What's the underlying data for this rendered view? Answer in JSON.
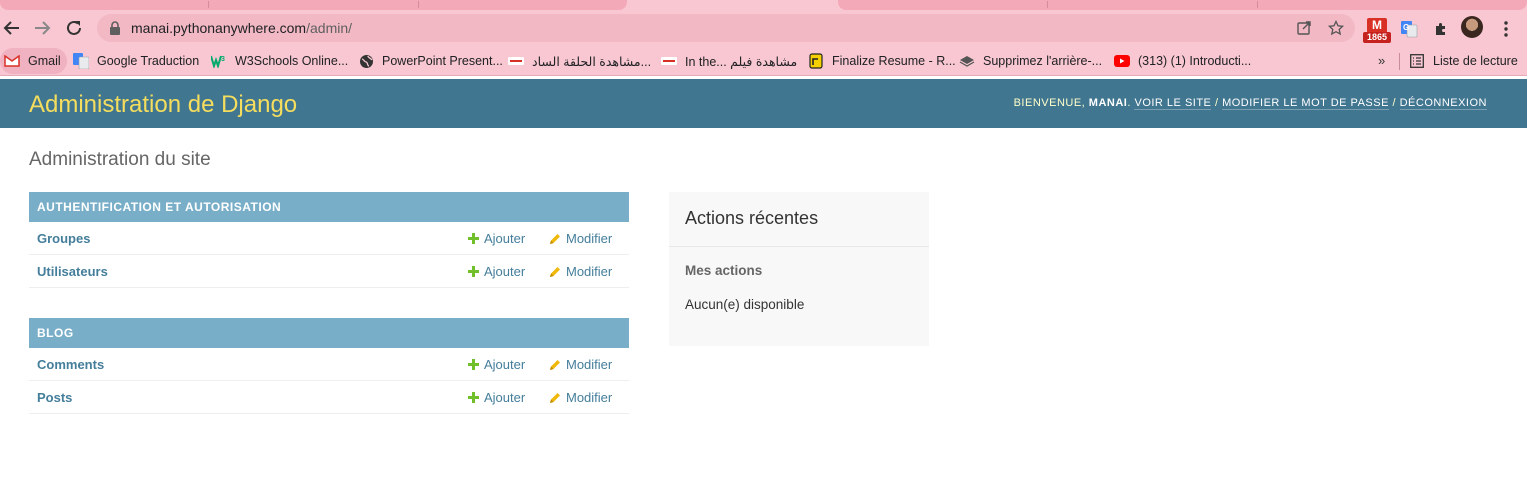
{
  "browser": {
    "url_host": "manai.pythonanywhere.com",
    "url_path": "/admin/",
    "gmail_badge": "1865",
    "bookmarks": [
      {
        "label": "Gmail",
        "icon": "gmail-icon"
      },
      {
        "label": "Google Traduction",
        "icon": "google-translate-icon"
      },
      {
        "label": "W3Schools Online...",
        "icon": "w3schools-icon"
      },
      {
        "label": "PowerPoint Present...",
        "icon": "globe-icon"
      },
      {
        "label": "مشاهدة الحلقة الساد...",
        "icon": "site-icon"
      },
      {
        "label": "In the... مشاهدة فيلم",
        "icon": "site-icon"
      },
      {
        "label": "Finalize Resume - R...",
        "icon": "resume-icon"
      },
      {
        "label": "Supprimez l'arrière-...",
        "icon": "layers-icon"
      },
      {
        "label": "(313) (1) Introducti...",
        "icon": "youtube-icon"
      }
    ],
    "more_bookmarks": "»",
    "reading_list": "Liste de lecture"
  },
  "header": {
    "branding": "Administration de Django",
    "welcome": "Bienvenue,",
    "username": "MANAI",
    "view_site": "Voir le site",
    "change_password": "Modifier le mot de passe",
    "logout": "Déconnexion"
  },
  "page_title": "Administration du site",
  "modules": [
    {
      "caption": "Authentification et autorisation",
      "models": [
        {
          "name": "Groupes",
          "add": "Ajouter",
          "change": "Modifier"
        },
        {
          "name": "Utilisateurs",
          "add": "Ajouter",
          "change": "Modifier"
        }
      ]
    },
    {
      "caption": "Blog",
      "models": [
        {
          "name": "Comments",
          "add": "Ajouter",
          "change": "Modifier"
        },
        {
          "name": "Posts",
          "add": "Ajouter",
          "change": "Modifier"
        }
      ]
    }
  ],
  "recent_actions": {
    "title": "Actions récentes",
    "mine": "Mes actions",
    "none": "Aucun(e) disponible"
  },
  "colors": {
    "header_bg": "#417690",
    "branding": "#f5dd5d",
    "module_caption_bg": "#79aec8",
    "link": "#447e9b",
    "add_green": "#70bf2b",
    "change_yellow": "#efb80b",
    "browser_chrome": "#f8c7d1"
  }
}
